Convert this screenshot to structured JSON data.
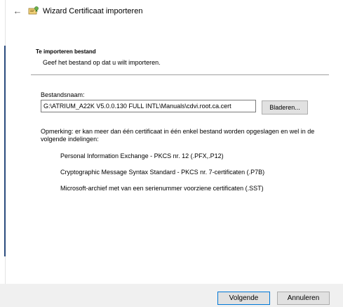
{
  "window": {
    "title": "Wizard Certificaat importeren"
  },
  "section": {
    "heading": "Te importeren bestand",
    "subtitle": "Geef het bestand op dat u wilt importeren."
  },
  "file": {
    "label": "Bestandsnaam:",
    "value": "G:\\ATRIUM_A22K V5.0.0.130 FULL INTL\\Manuals\\cdvi.root.ca.cert",
    "browse_label": "Bladeren..."
  },
  "note": "Opmerking: er kan meer dan één certificaat in één enkel bestand worden opgeslagen en wel in de volgende indelingen:",
  "formats": [
    "Personal Information Exchange - PKCS nr. 12 (.PFX,.P12)",
    "Cryptographic Message Syntax Standard - PKCS nr. 7-certificaten (.P7B)",
    "Microsoft-archief met van een serienummer voorziene certificaten (.SST)"
  ],
  "buttons": {
    "next": "Volgende",
    "cancel": "Annuleren"
  },
  "icons": {
    "back": "back-arrow-icon",
    "wizard": "certificate-wizard-icon"
  }
}
